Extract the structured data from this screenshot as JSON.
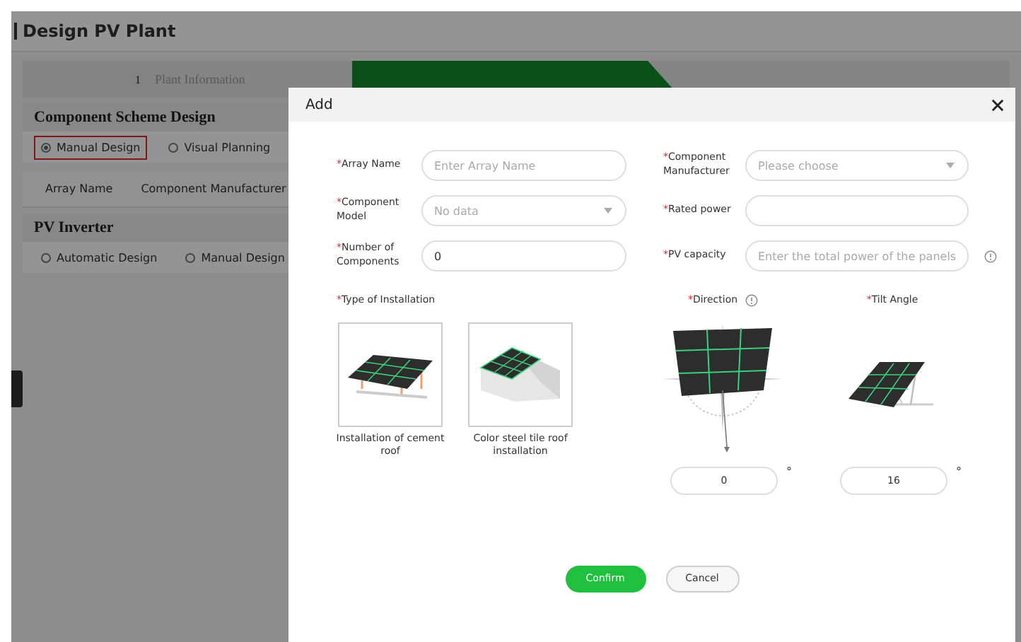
{
  "page": {
    "title": "Design PV Plant"
  },
  "steps": [
    {
      "number": "1",
      "label": "Plant Information",
      "selected": false
    },
    {
      "selected": true
    },
    {
      "selected": false
    }
  ],
  "component_scheme": {
    "heading": "Component Scheme Design",
    "options": [
      {
        "label": "Manual Design",
        "selected": true,
        "highlighted": true
      },
      {
        "label": "Visual Planning",
        "selected": false,
        "highlighted": false
      }
    ],
    "columns": [
      "Array Name",
      "Component Manufacturer"
    ]
  },
  "pv_inverter": {
    "heading": "PV Inverter",
    "options": [
      {
        "label": "Automatic Design",
        "selected": false,
        "highlighted": false
      },
      {
        "label": "Manual Design",
        "selected": false,
        "highlighted": false
      }
    ]
  },
  "dialog": {
    "title": "Add",
    "fields": [
      {
        "required_mark": "*",
        "label": "Array Name",
        "kind": "input",
        "placeholder": "Enter Array Name"
      },
      {
        "required_mark": "*",
        "label": "Component Manufacturer",
        "kind": "select",
        "placeholder": "Please choose"
      },
      {
        "required_mark": "*",
        "label": "Component Model",
        "kind": "select",
        "placeholder": "No data"
      },
      {
        "required_mark": "*",
        "label": "Rated power",
        "kind": "input"
      },
      {
        "required_mark": "*",
        "label": "Number of Components",
        "kind": "input",
        "value": "0"
      },
      {
        "required_mark": "*",
        "label": "PV capacity",
        "kind": "input",
        "placeholder": "Enter the total power of the panels",
        "info": true
      }
    ],
    "installation": {
      "required_mark": "*",
      "label": "Type of Installation",
      "options": [
        {
          "label": "Installation of cement roof",
          "kind": "ground"
        },
        {
          "label": "Color steel tile roof installation",
          "kind": "roof"
        }
      ]
    },
    "direction": {
      "required_mark": "*",
      "label": "Direction",
      "info": true,
      "value": "0",
      "unit": "°"
    },
    "tilt": {
      "required_mark": "*",
      "label": "Tilt Angle",
      "value": "16",
      "unit": "°"
    },
    "buttons": [
      {
        "label": "Confirm",
        "kind": "primary"
      },
      {
        "label": "Cancel",
        "kind": "secondary"
      }
    ]
  }
}
